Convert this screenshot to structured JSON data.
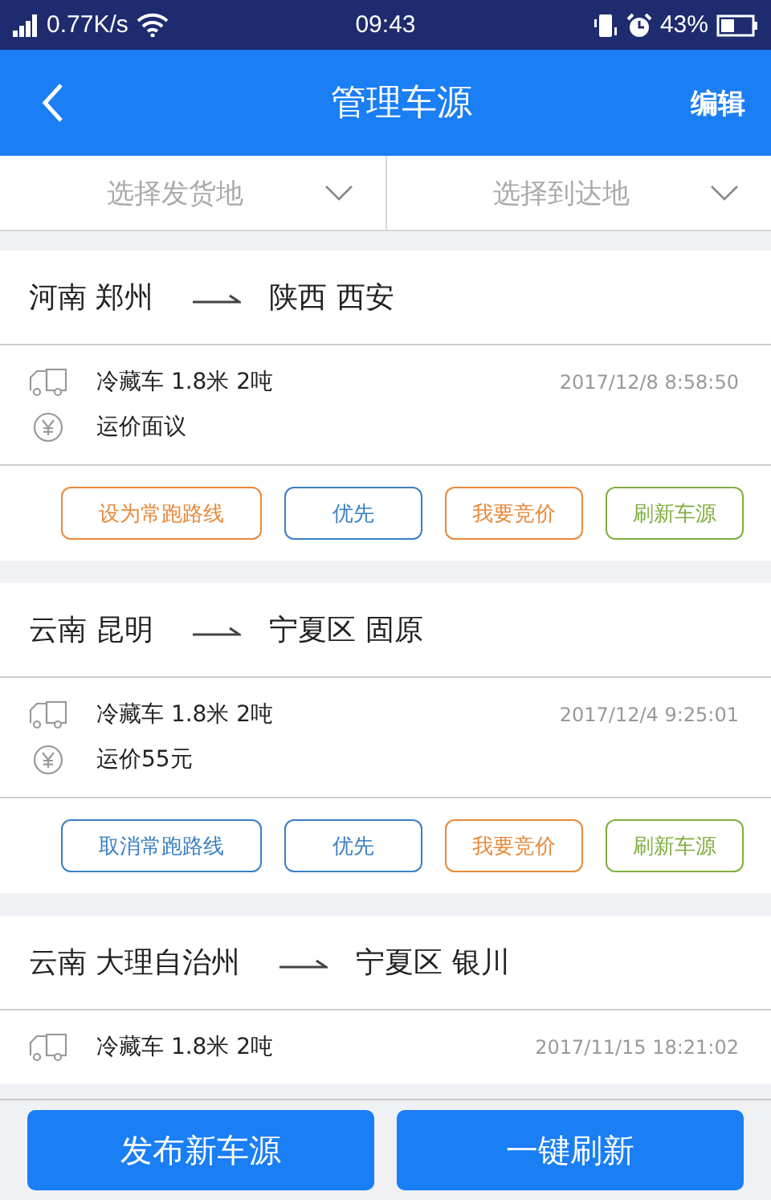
{
  "status_bar": {
    "speed": "0.77K/s",
    "time": "09:43",
    "battery": "43%"
  },
  "header": {
    "title": "管理车源",
    "action": "编辑"
  },
  "filters": [
    {
      "placeholder": "选择发货地"
    },
    {
      "placeholder": "选择到达地"
    }
  ],
  "cards": [
    {
      "from": "河南 郑州",
      "to": "陕西 西安",
      "vehicle": "冷藏车 1.8米 2吨",
      "time": "2017/12/8   8:58:50",
      "price": "运价面议",
      "buttons": [
        {
          "label": "设为常跑路线",
          "color": "#e8893a"
        },
        {
          "label": "优先",
          "color": "#3a7fc4"
        },
        {
          "label": "我要竞价",
          "color": "#e8893a"
        },
        {
          "label": "刷新车源",
          "color": "#7fae3e"
        }
      ]
    },
    {
      "from": "云南 昆明",
      "to": "宁夏区 固原",
      "vehicle": "冷藏车 1.8米 2吨",
      "time": "2017/12/4   9:25:01",
      "price": "运价55元",
      "buttons": [
        {
          "label": "取消常跑路线",
          "color": "#3a7fc4"
        },
        {
          "label": "优先",
          "color": "#3a7fc4"
        },
        {
          "label": "我要竞价",
          "color": "#e8893a"
        },
        {
          "label": "刷新车源",
          "color": "#7fae3e"
        }
      ]
    },
    {
      "from": "云南 大理自治州",
      "to": "宁夏区 银川",
      "vehicle": "冷藏车 1.8米 2吨",
      "time": "2017/11/15   18:21:02"
    }
  ],
  "footer_buttons": [
    "发布新车源",
    "一键刷新"
  ]
}
